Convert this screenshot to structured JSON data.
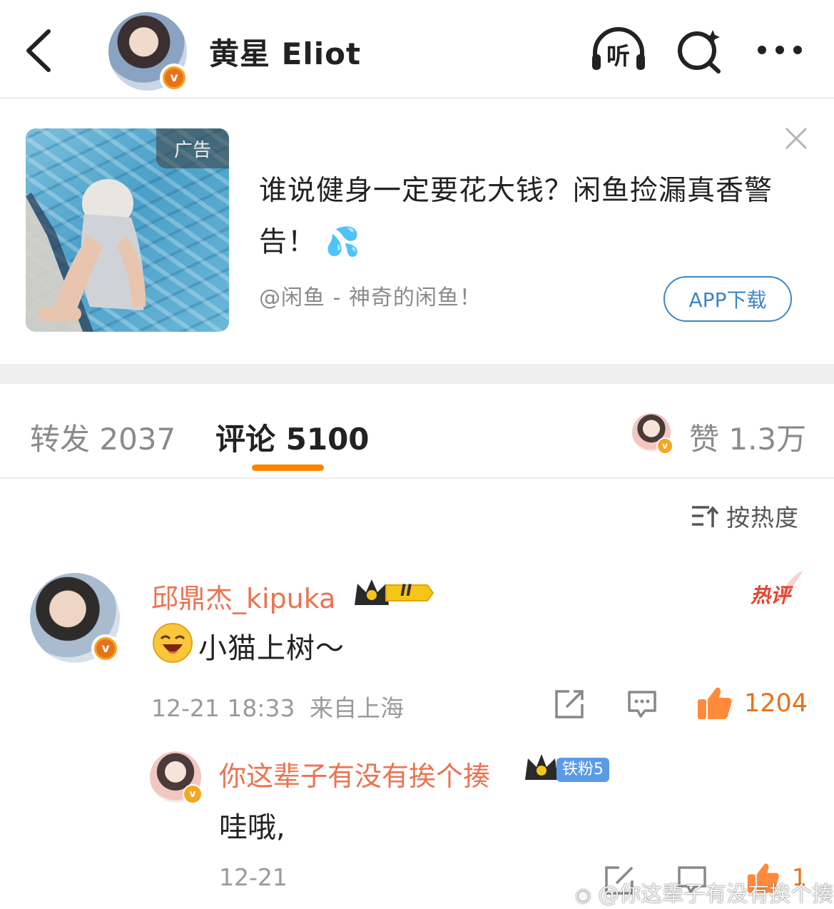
{
  "header": {
    "author_name": "黄星 Eliot",
    "listen_label": "听"
  },
  "ad": {
    "tag": "广告",
    "title": "谁说健身一定要花大钱？闲鱼捡漏真香警告！ 💦",
    "source": "@闲鱼 - 神奇的闲鱼！",
    "button_label": "APP下载"
  },
  "tabs": {
    "repost_label": "转发 2037",
    "comment_label": "评论 5100",
    "like_label": "赞 1.3万"
  },
  "sort": {
    "label": "按热度"
  },
  "comment": {
    "username": "邱鼎杰_kipuka",
    "level_badge": "II",
    "hot_label": "热评",
    "text": "小猫上树～",
    "time": "12-21 18:33",
    "location": "来自上海",
    "like_count": "1204",
    "accent_color": "#eb7350"
  },
  "reply": {
    "username": "你这辈子有没有挨个揍",
    "fan_badge": "铁粉5",
    "text": "哇哦,",
    "time": "12-21",
    "like_count": "1"
  },
  "watermark": "@你这辈子有没有挨个揍"
}
